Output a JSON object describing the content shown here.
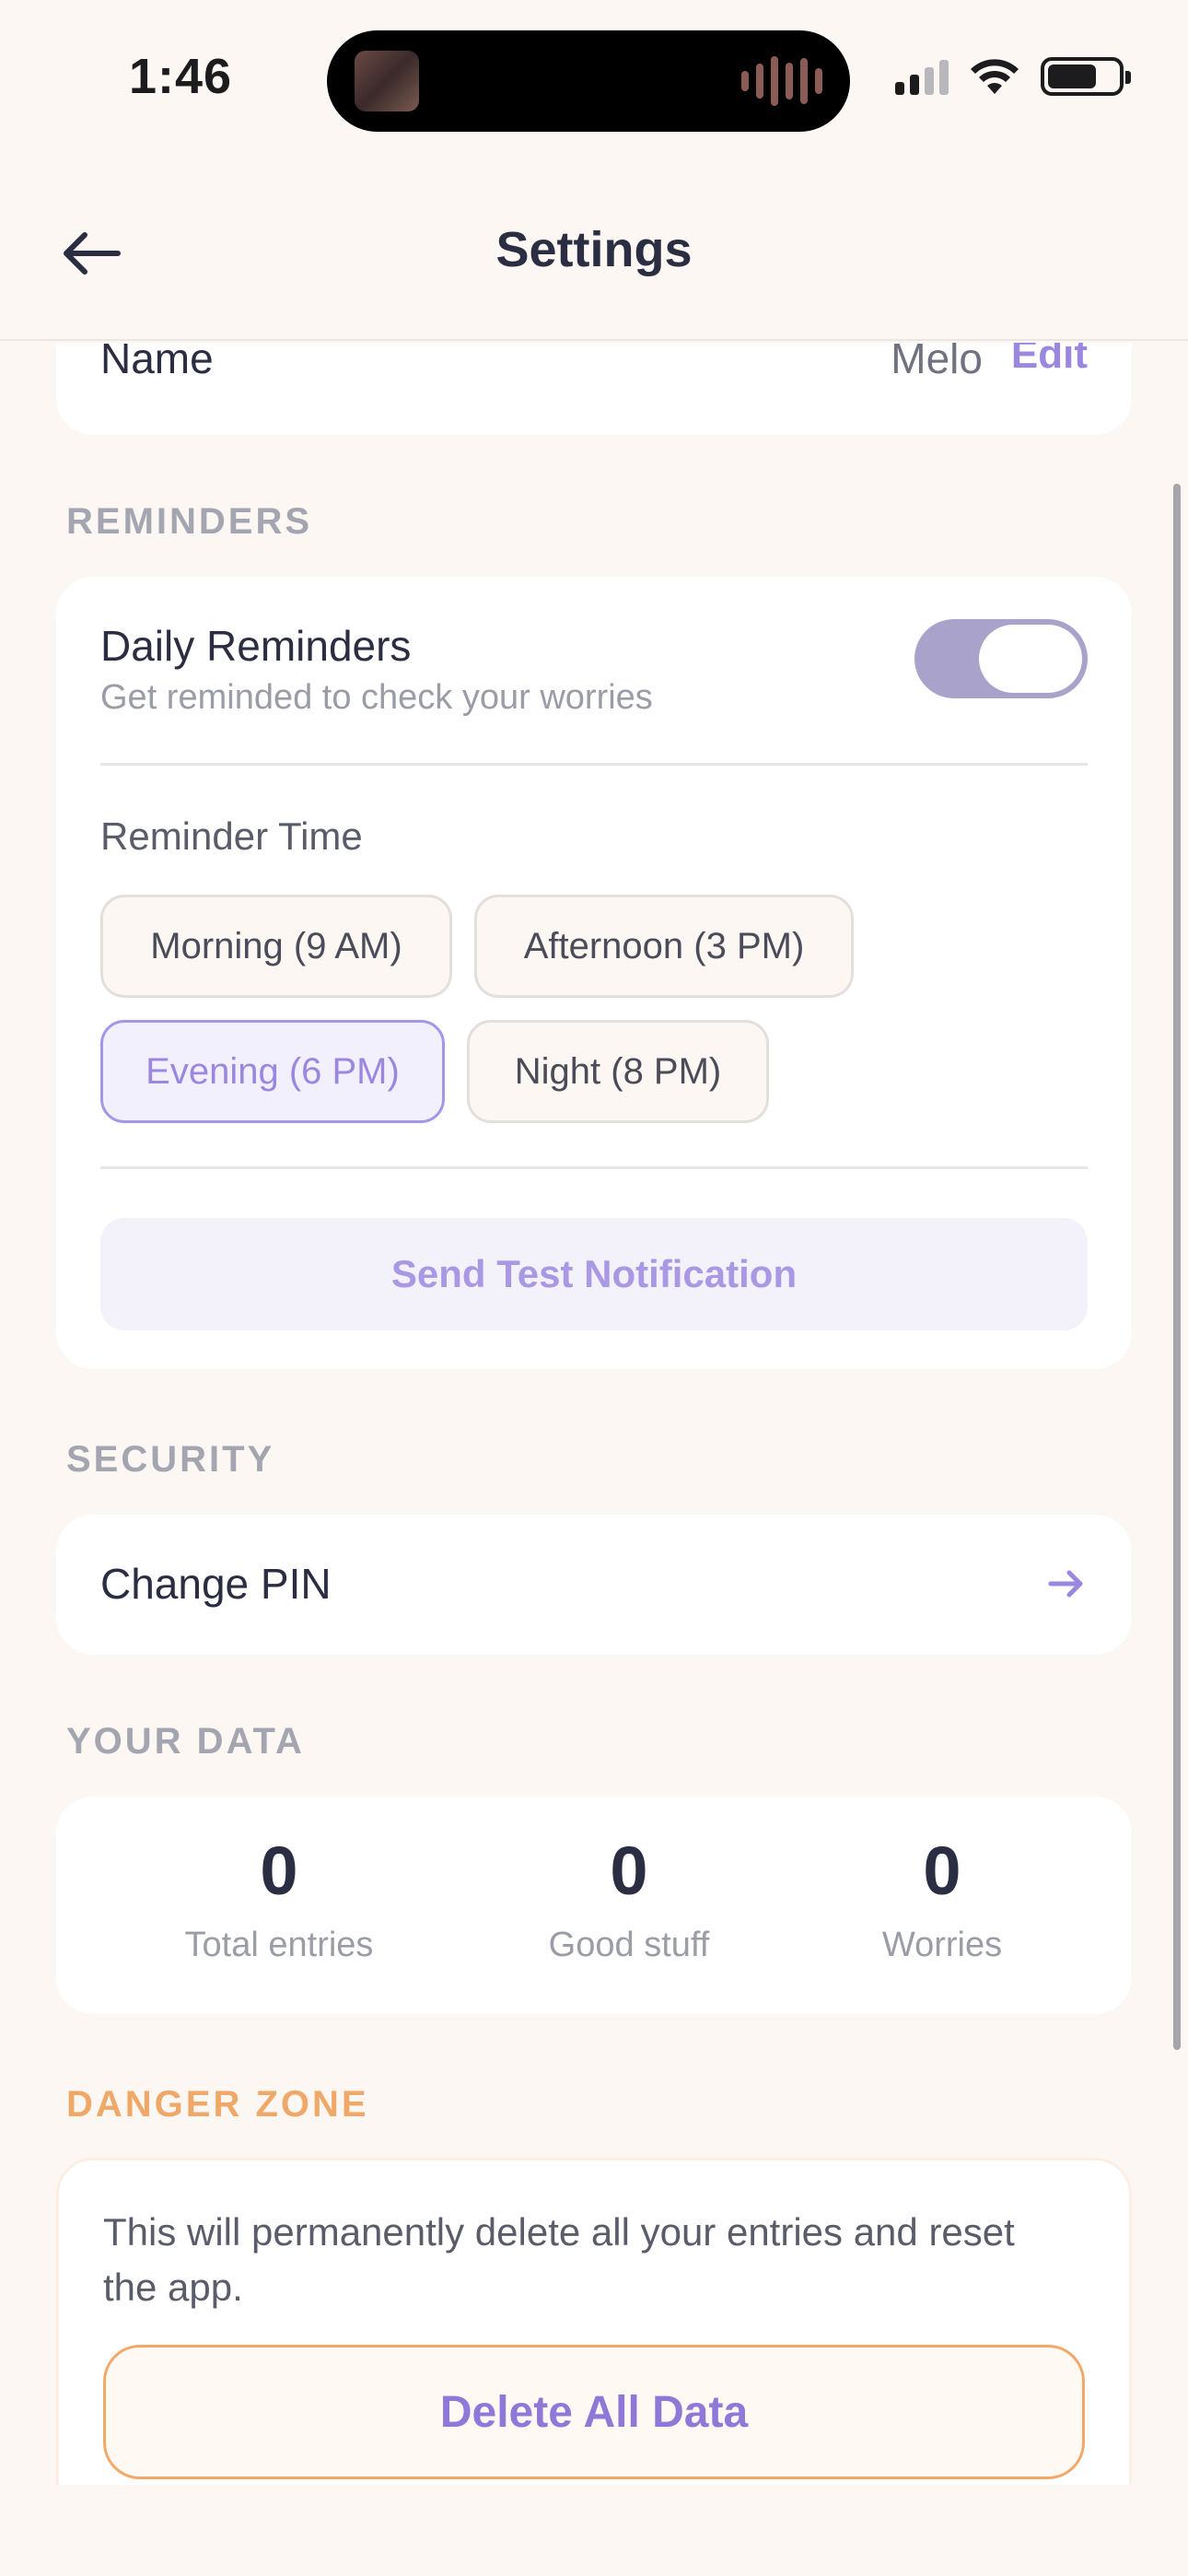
{
  "status_bar": {
    "time": "1:46"
  },
  "header": {
    "title": "Settings"
  },
  "profile": {
    "name_label": "Name",
    "name_value": "Melo",
    "edit_label": "Edit"
  },
  "reminders": {
    "section_label": "REMINDERS",
    "daily_title": "Daily Reminders",
    "daily_subtitle": "Get reminded to check your worries",
    "toggle_on": true,
    "time_heading": "Reminder Time",
    "options": [
      "Morning (9 AM)",
      "Afternoon (3 PM)",
      "Evening (6 PM)",
      "Night (8 PM)"
    ],
    "selected_option": "Evening (6 PM)",
    "test_button": "Send Test Notification"
  },
  "security": {
    "section_label": "SECURITY",
    "change_pin": "Change PIN"
  },
  "your_data": {
    "section_label": "YOUR DATA",
    "stats": [
      {
        "value": "0",
        "label": "Total entries"
      },
      {
        "value": "0",
        "label": "Good stuff"
      },
      {
        "value": "0",
        "label": "Worries"
      }
    ]
  },
  "danger_zone": {
    "section_label": "DANGER ZONE",
    "warning_text": "This will permanently delete all your entries and reset the app.",
    "delete_button": "Delete All Data"
  },
  "colors": {
    "accent": "#9b87e0",
    "danger": "#f0a868",
    "background": "#fdf7f3"
  }
}
